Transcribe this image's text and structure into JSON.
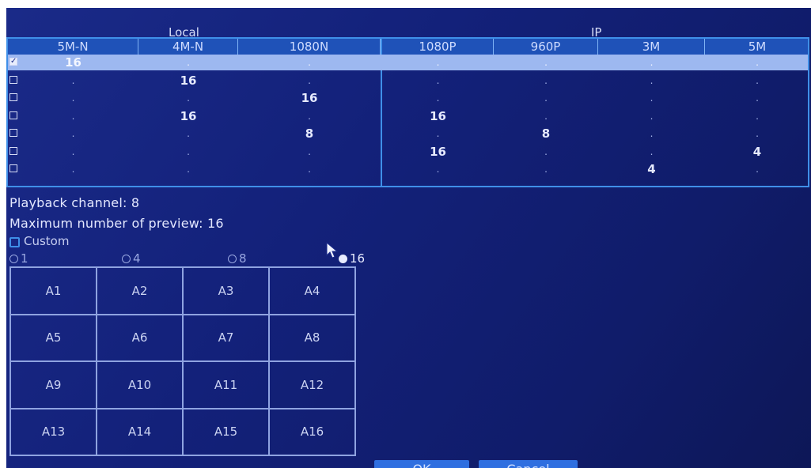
{
  "group_headers": {
    "local": "Local",
    "ip": "IP"
  },
  "columns": [
    "5M-N",
    "4M-N",
    "1080N",
    "1080P",
    "960P",
    "3M",
    "5M"
  ],
  "rows": [
    {
      "checked": true,
      "cells": [
        "16",
        ".",
        ".",
        ".",
        ".",
        ".",
        "."
      ]
    },
    {
      "checked": false,
      "cells": [
        ".",
        "16",
        ".",
        ".",
        ".",
        ".",
        "."
      ]
    },
    {
      "checked": false,
      "cells": [
        ".",
        ".",
        "16",
        ".",
        ".",
        ".",
        "."
      ]
    },
    {
      "checked": false,
      "cells": [
        ".",
        "16",
        ".",
        "16",
        ".",
        ".",
        "."
      ]
    },
    {
      "checked": false,
      "cells": [
        ".",
        ".",
        "8",
        ".",
        "8",
        ".",
        "."
      ]
    },
    {
      "checked": false,
      "cells": [
        ".",
        ".",
        ".",
        "16",
        ".",
        ".",
        "4"
      ]
    },
    {
      "checked": false,
      "cells": [
        ".",
        ".",
        ".",
        ".",
        ".",
        "4",
        "."
      ]
    }
  ],
  "info": {
    "playback": "Playback channel: 8",
    "max_preview": "Maximum number of preview: 16",
    "custom_label": "Custom"
  },
  "split_options": [
    {
      "label": "1",
      "checked": false
    },
    {
      "label": "4",
      "checked": false
    },
    {
      "label": "8",
      "checked": false
    },
    {
      "label": "16",
      "checked": true
    }
  ],
  "channels": [
    "A1",
    "A2",
    "A3",
    "A4",
    "A5",
    "A6",
    "A7",
    "A8",
    "A9",
    "A10",
    "A11",
    "A12",
    "A13",
    "A14",
    "A15",
    "A16"
  ],
  "buttons": {
    "ok": "OK",
    "cancel": "Cancel"
  },
  "colors": {
    "background": "#13217a",
    "accent": "#3f8fe8",
    "header": "#1f52b8",
    "selected_row": "#9db8f0"
  }
}
